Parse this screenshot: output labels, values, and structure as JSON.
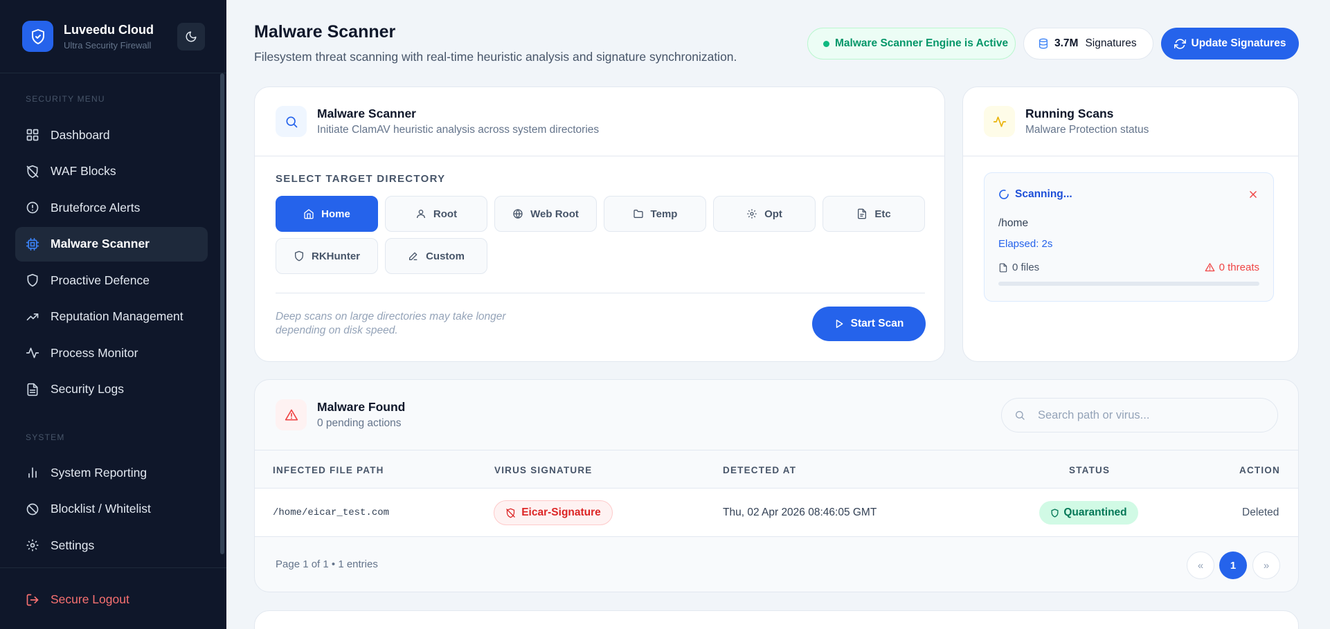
{
  "brand": {
    "name": "Luveedu Cloud",
    "subtitle": "Ultra Security Firewall"
  },
  "sidebar": {
    "security_label": "SECURITY MENU",
    "security_items": [
      {
        "label": "Dashboard",
        "icon": "grid-icon"
      },
      {
        "label": "WAF Blocks",
        "icon": "shield-off-icon"
      },
      {
        "label": "Bruteforce Alerts",
        "icon": "alert-circle-icon"
      },
      {
        "label": "Malware Scanner",
        "icon": "cpu-icon",
        "active": true
      },
      {
        "label": "Proactive Defence",
        "icon": "shield-icon"
      },
      {
        "label": "Reputation Management",
        "icon": "trending-up-icon"
      },
      {
        "label": "Process Monitor",
        "icon": "activity-icon"
      },
      {
        "label": "Security Logs",
        "icon": "file-text-icon"
      }
    ],
    "system_label": "SYSTEM",
    "system_items": [
      {
        "label": "System Reporting",
        "icon": "bar-chart-icon"
      },
      {
        "label": "Blocklist / Whitelist",
        "icon": "ban-icon"
      },
      {
        "label": "Settings",
        "icon": "gear-icon"
      }
    ],
    "logout_label": "Secure Logout"
  },
  "header": {
    "title": "Malware Scanner",
    "subtitle": "Filesystem threat scanning with real-time heuristic analysis and signature synchronization.",
    "engine_status": "Malware Scanner Engine is Active",
    "signatures_count": "3.7M",
    "signatures_label": "Signatures",
    "update_label": "Update Signatures"
  },
  "scanner": {
    "title": "Malware Scanner",
    "subtitle": "Initiate ClamAV heuristic analysis across system directories",
    "select_label": "SELECT TARGET DIRECTORY",
    "directories": [
      {
        "label": "Home",
        "icon": "home-icon",
        "active": true
      },
      {
        "label": "Root",
        "icon": "user-icon"
      },
      {
        "label": "Web Root",
        "icon": "globe-icon"
      },
      {
        "label": "Temp",
        "icon": "folder-icon"
      },
      {
        "label": "Opt",
        "icon": "gear-icon"
      },
      {
        "label": "Etc",
        "icon": "file-icon"
      },
      {
        "label": "RKHunter",
        "icon": "shield-icon"
      },
      {
        "label": "Custom",
        "icon": "pencil-icon"
      }
    ],
    "note": "Deep scans on large directories may take longer depending on disk speed.",
    "start_label": "Start Scan"
  },
  "running": {
    "title": "Running Scans",
    "subtitle": "Malware Protection status",
    "status": "Scanning...",
    "path": "/home",
    "elapsed": "Elapsed: 2s",
    "files": "0 files",
    "threats": "0 threats",
    "progress": 0
  },
  "found": {
    "title": "Malware Found",
    "subtitle": "0 pending actions",
    "search_placeholder": "Search path or virus...",
    "columns": [
      "INFECTED FILE PATH",
      "VIRUS SIGNATURE",
      "DETECTED AT",
      "STATUS",
      "ACTION"
    ],
    "rows": [
      {
        "path": "/home/eicar_test.com",
        "signature": "Eicar-Signature",
        "detected": "Thu, 02 Apr 2026 08:46:05 GMT",
        "status": "Quarantined",
        "action": "Deleted"
      }
    ],
    "pager_text": "Page 1 of 1 • 1 entries",
    "prev": "«",
    "current_page": "1",
    "next": "»"
  },
  "colors": {
    "accent": "#2563eb",
    "sidebar_bg": "#0f172a",
    "danger": "#dc2626",
    "success": "#059669"
  }
}
